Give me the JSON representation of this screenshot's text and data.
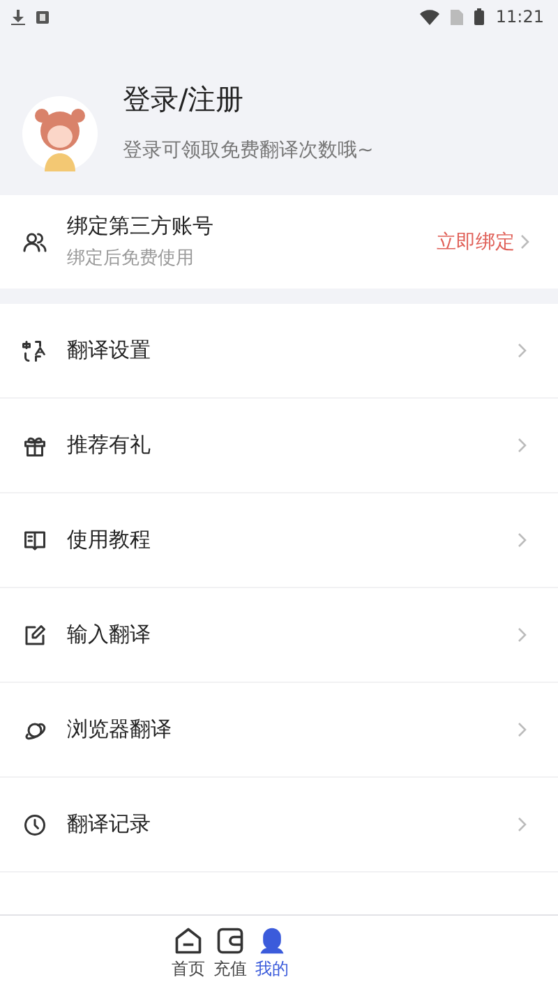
{
  "status_bar": {
    "time": "11:21"
  },
  "profile": {
    "title": "登录/注册",
    "subtitle": "登录可领取免费翻译次数哦~"
  },
  "bind_card": {
    "title": "绑定第三方账号",
    "subtitle": "绑定后免费使用",
    "action": "立即绑定"
  },
  "menu": [
    {
      "kind": "translate",
      "label": "翻译设置"
    },
    {
      "kind": "gift",
      "label": "推荐有礼"
    },
    {
      "kind": "book",
      "label": "使用教程"
    },
    {
      "kind": "edit",
      "label": "输入翻译"
    },
    {
      "kind": "planet",
      "label": "浏览器翻译"
    },
    {
      "kind": "clock",
      "label": "翻译记录"
    }
  ],
  "bottom_nav": [
    {
      "kind": "home",
      "label": "首页",
      "selected": false
    },
    {
      "kind": "wallet",
      "label": "充值",
      "selected": false
    },
    {
      "kind": "user",
      "label": "我的",
      "selected": true
    }
  ]
}
